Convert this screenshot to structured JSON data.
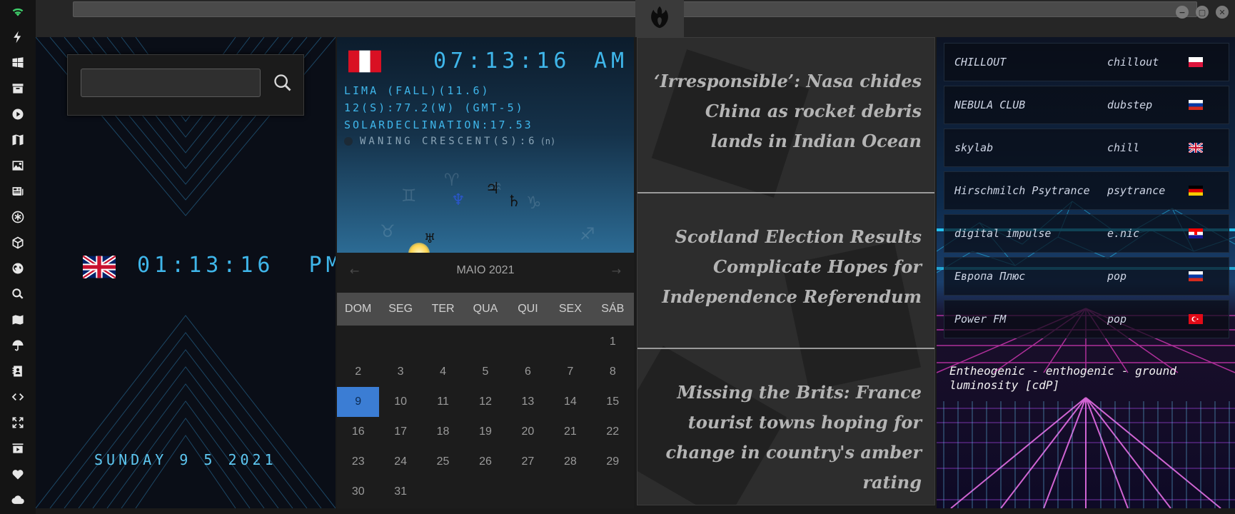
{
  "rail": {
    "icons": [
      "wifi-icon",
      "bolt-icon",
      "windows-icon",
      "archive-icon",
      "play-icon",
      "maps-icon",
      "image-icon",
      "news-icon",
      "star-of-life-icon",
      "hexagon-icon",
      "globe-icon",
      "search-icon",
      "map-icon",
      "umbrella-icon",
      "contacts-icon",
      "code-icon",
      "expand-icon",
      "youtube-icon",
      "heart-icon",
      "cloud-icon"
    ]
  },
  "titlebar": {
    "logo": "rebel-alliance-icon",
    "buttons": [
      "−",
      "▢",
      "✕"
    ]
  },
  "clock": {
    "search_placeholder": "",
    "time": "01:13:16",
    "ampm": "PM",
    "date": "SUNDAY 9 5 2021"
  },
  "astro": {
    "time": "07:13:16",
    "ampm": "AM",
    "line1": "LIMA (FALL)(11.6)",
    "line2": "12(S):77.2(W) (GMT-5)",
    "line3": "SOLARDECLINATION:17.53",
    "moon": "WANING CRESCENT(S):6",
    "moon_suffix": "(n)"
  },
  "calendar": {
    "month": "MAIO 2021",
    "prev": "←",
    "next": "→",
    "days": [
      "DOM",
      "SEG",
      "TER",
      "QUA",
      "QUI",
      "SEX",
      "SÁB"
    ],
    "cells": [
      "",
      "",
      "",
      "",
      "",
      "",
      "1",
      "2",
      "3",
      "4",
      "5",
      "6",
      "7",
      "8",
      "9",
      "10",
      "11",
      "12",
      "13",
      "14",
      "15",
      "16",
      "17",
      "18",
      "19",
      "20",
      "21",
      "22",
      "23",
      "24",
      "25",
      "26",
      "27",
      "28",
      "29",
      "30",
      "31"
    ],
    "selected": "9"
  },
  "news": {
    "items": [
      "‘Irresponsible’: Nasa chides China as rocket debris lands in Indian Ocean",
      "Scotland Election Results Complicate Hopes for Independence Referendum",
      "Missing the Brits: France tourist towns hoping for change in country's amber rating"
    ]
  },
  "radio": {
    "stations": [
      {
        "name": "CHILLOUT",
        "genre": "chillout",
        "flag": "pl"
      },
      {
        "name": "NEBULA CLUB",
        "genre": "dubstep",
        "flag": "ru"
      },
      {
        "name": "skylab",
        "genre": "chill",
        "flag": "gb"
      },
      {
        "name": "Hirschmilch Psytrance",
        "genre": "psytrance",
        "flag": "de"
      },
      {
        "name": "digital impulse",
        "genre": "e.nic",
        "flag": "hr"
      },
      {
        "name": "Европа Плюс",
        "genre": "pop",
        "flag": "ru"
      },
      {
        "name": "Power FM",
        "genre": "pop",
        "flag": "tr"
      }
    ],
    "now_playing": "Entheogenic - enthogenic - ground luminosity [cdP]"
  },
  "colors": {
    "digital": "#3fb6ea",
    "calendar_selected": "#3b7dd4",
    "rail_bg": "#141414",
    "news_text": "#b4b4b4",
    "radio_grid_pink": "#e23bc0",
    "radio_grid_cyan": "#27d0ff"
  }
}
